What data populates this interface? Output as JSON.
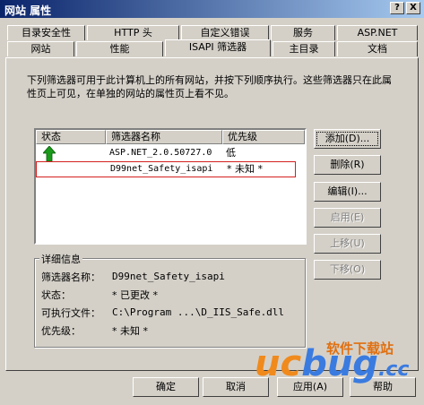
{
  "window": {
    "title": "网站 属性",
    "help_button": "?",
    "close_button": "X"
  },
  "tabs_row1": [
    "目录安全性",
    "HTTP 头",
    "自定义错误",
    "服务",
    "ASP.NET"
  ],
  "tabs_row2": [
    "网站",
    "性能",
    "ISAPI 筛选器",
    "主目录",
    "文档"
  ],
  "description": "下列筛选器可用于此计算机上的所有网站，并按下列顺序执行。这些筛选器只在此属性页上可见，在单独的网站的属性页上看不见。",
  "list": {
    "headers": [
      "状态",
      "筛选器名称",
      "优先级"
    ],
    "rows": [
      {
        "status_icon": "green-up-arrow-icon",
        "name": "ASP.NET_2.0.50727.0",
        "priority": "低"
      },
      {
        "status_icon": "",
        "name": "D99net_Safety_isapi",
        "priority": "* 未知 *"
      }
    ]
  },
  "side_buttons": {
    "add": "添加(D)...",
    "remove": "删除(R)",
    "edit": "编辑(I)...",
    "enable": "启用(E)",
    "up": "上移(U)",
    "down": "下移(O)"
  },
  "details": {
    "title": "详细信息",
    "name_label": "筛选器名称：",
    "name_value": "D99net_Safety_isapi",
    "status_label": "状态：",
    "status_value": "* 已更改 *",
    "exe_label": "可执行文件：",
    "exe_value": "C:\\Program ...\\D_IIS_Safe.dll",
    "priority_label": "优先级：",
    "priority_value": "* 未知 *"
  },
  "bottom_buttons": {
    "ok": "确定",
    "cancel": "取消",
    "apply": "应用(A)",
    "help": "帮助"
  },
  "watermark": {
    "cn": "软件下载站",
    "en1": "uc",
    "en2": "bug",
    "en3": ".cc"
  }
}
